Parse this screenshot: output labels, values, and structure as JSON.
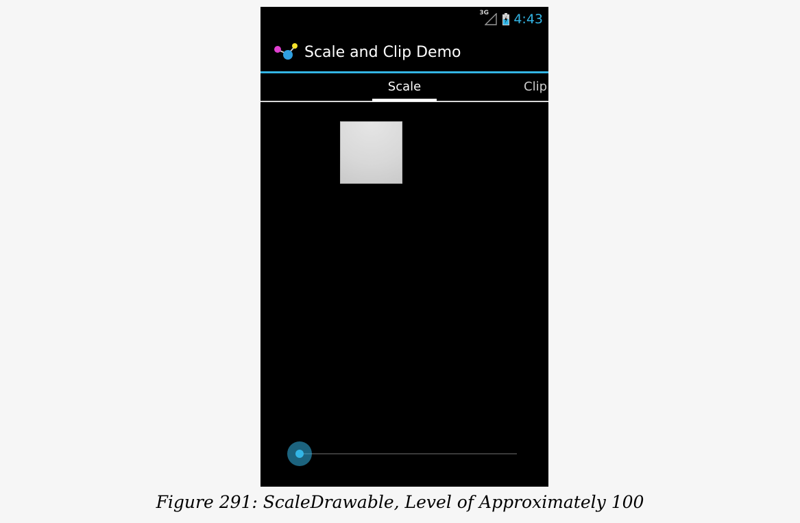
{
  "status_bar": {
    "network": "3G",
    "time": "4:43",
    "accent_color": "#33b5e5"
  },
  "action_bar": {
    "title": "Scale and Clip Demo",
    "icon": "app-molecule-icon"
  },
  "tabs": [
    {
      "label": "Scale",
      "selected": true
    },
    {
      "label": "Clip",
      "selected": false
    }
  ],
  "seekbar": {
    "progress_fraction": 0.01
  },
  "caption": "Figure 291: ScaleDrawable, Level of Approximately 100"
}
